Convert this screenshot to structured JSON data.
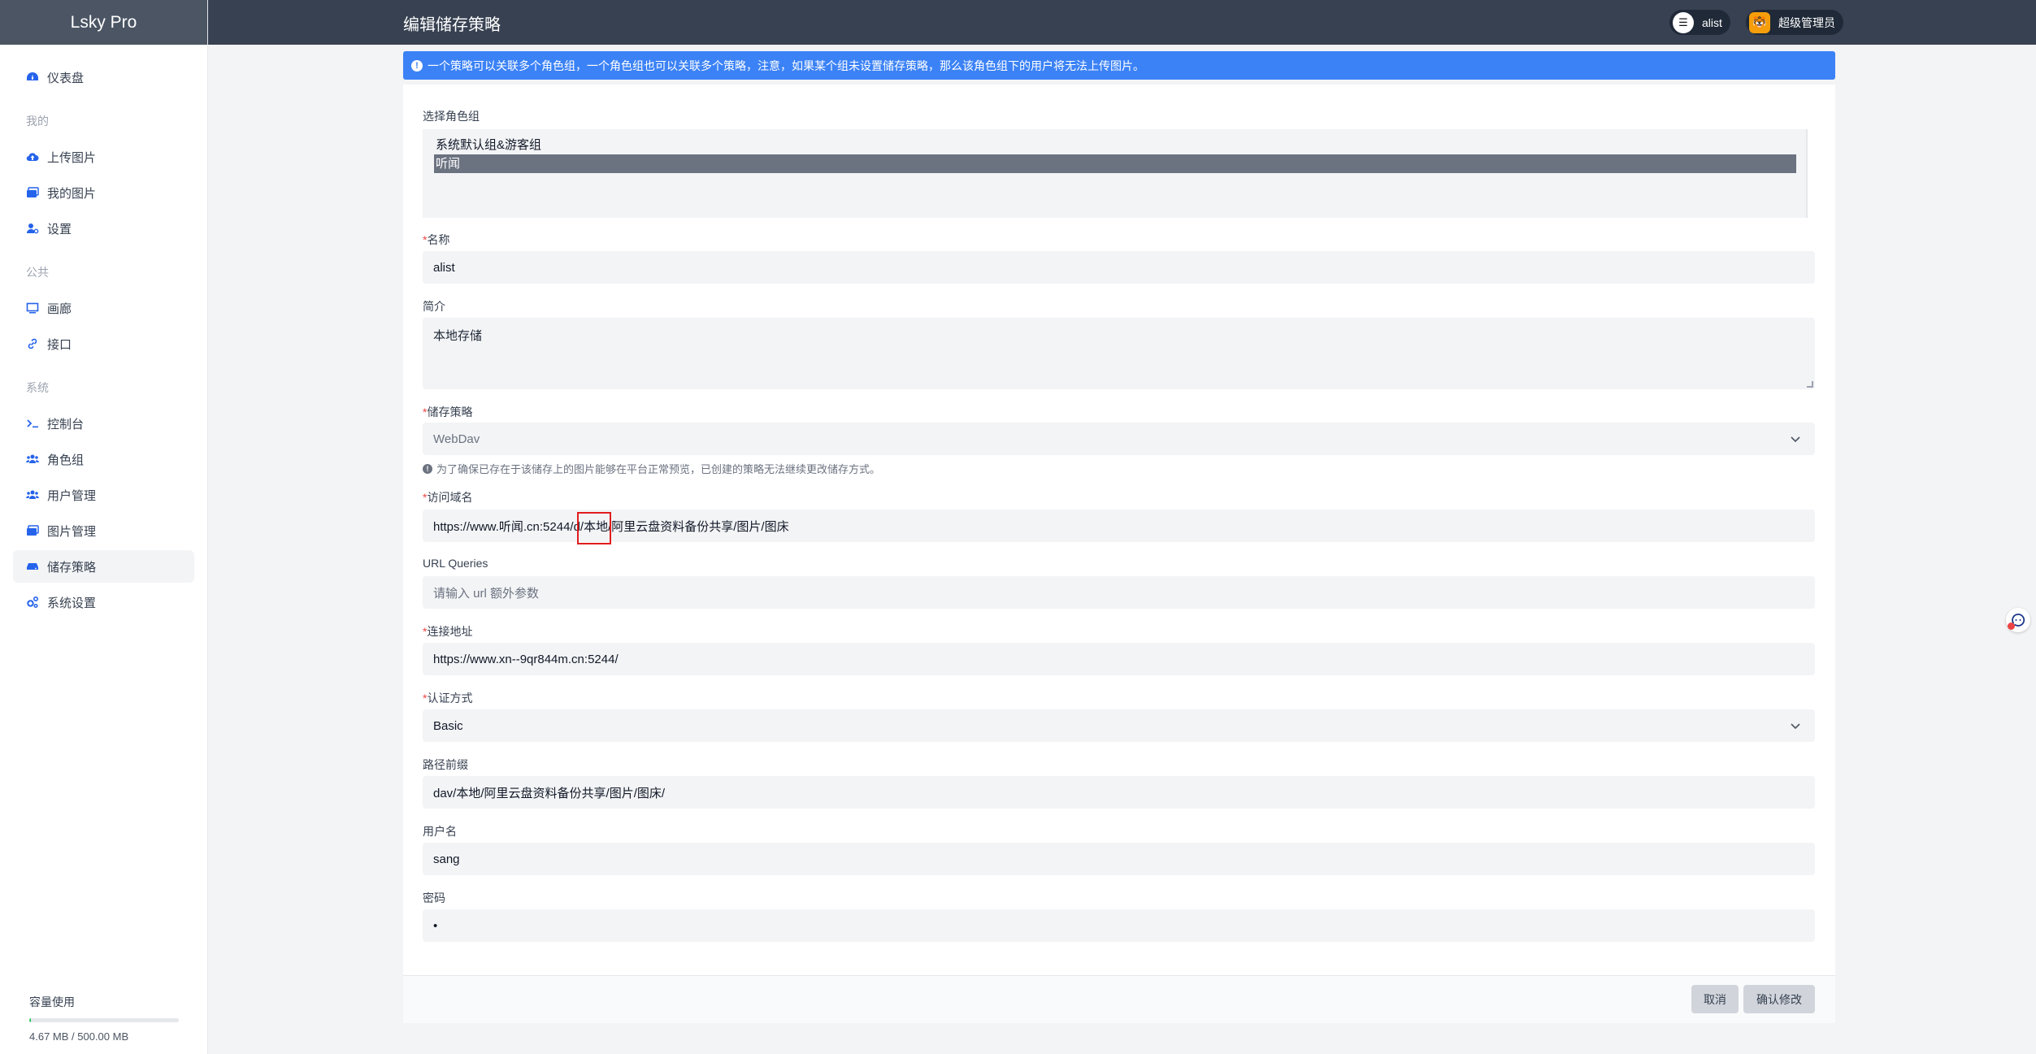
{
  "brand": "Lsky Pro",
  "page_title": "编辑储存策略",
  "topbar": {
    "user1_label": "alist",
    "user2_label": "超级管理员"
  },
  "sidebar": {
    "dashboard": "仪表盘",
    "group_mine": "我的",
    "upload": "上传图片",
    "my_images": "我的图片",
    "settings": "设置",
    "group_public": "公共",
    "gallery": "画廊",
    "api": "接口",
    "group_system": "系统",
    "console": "控制台",
    "roles": "角色组",
    "users": "用户管理",
    "image_manage": "图片管理",
    "strategies": "储存策略",
    "system_settings": "系统设置"
  },
  "storage": {
    "title": "容量使用",
    "text": "4.67 MB / 500.00 MB",
    "used_fraction": 0.0093
  },
  "alert": "一个策略可以关联多个角色组，一个角色组也可以关联多个策略，注意，如果某个组未设置储存策略，那么该角色组下的用户将无法上传图片。",
  "form": {
    "role_label": "选择角色组",
    "role_options": [
      "系统默认组&游客组",
      "听闻"
    ],
    "name_label": "名称",
    "name_value": "alist",
    "intro_label": "简介",
    "intro_value": "本地存储",
    "strategy_label": "储存策略",
    "strategy_value": "WebDav",
    "strategy_hint": "为了确保已存在于该储存上的图片能够在平台正常预览，已创建的策略无法继续更改储存方式。",
    "domain_label": "访问域名",
    "domain_value": "https://www.听闻.cn:5244/d/本地/阿里云盘资料备份共享/图片/图床",
    "queries_label": "URL Queries",
    "queries_placeholder": "请输入 url 额外参数",
    "conn_label": "连接地址",
    "conn_value": "https://www.xn--9qr844m.cn:5244/",
    "auth_label": "认证方式",
    "auth_value": "Basic",
    "prefix_label": "路径前缀",
    "prefix_value": "dav/本地/阿里云盘资料备份共享/图片/图床/",
    "username_label": "用户名",
    "username_value": "sang",
    "password_label": "密码",
    "password_value": "•"
  },
  "buttons": {
    "cancel": "取消",
    "confirm": "确认修改"
  }
}
